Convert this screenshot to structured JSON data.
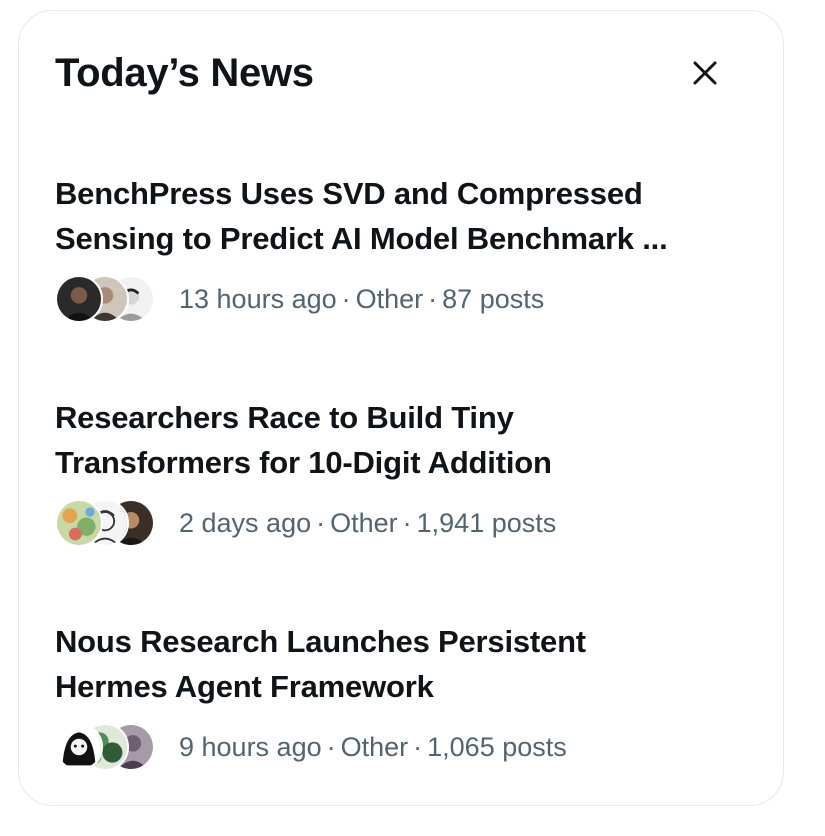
{
  "header": {
    "title": "Today’s News",
    "close_icon": "close-icon"
  },
  "news": [
    {
      "headline_line1": "BenchPress Uses SVD and Compressed",
      "headline_line2": "Sensing to Predict AI Model Benchmark ...",
      "time": "13 hours ago",
      "category": "Other",
      "posts": "87 posts"
    },
    {
      "headline_line1": "Researchers Race to Build Tiny",
      "headline_line2": "Transformers for 10-Digit Addition",
      "time": "2 days ago",
      "category": "Other",
      "posts": "1,941 posts"
    },
    {
      "headline_line1": "Nous Research Launches Persistent",
      "headline_line2": "Hermes Agent Framework",
      "time": "9 hours ago",
      "category": "Other",
      "posts": "1,065 posts"
    }
  ],
  "separator": "·",
  "colors": {
    "text_primary": "#0f1419",
    "text_secondary": "#536471",
    "border": "#e6e9ec"
  }
}
